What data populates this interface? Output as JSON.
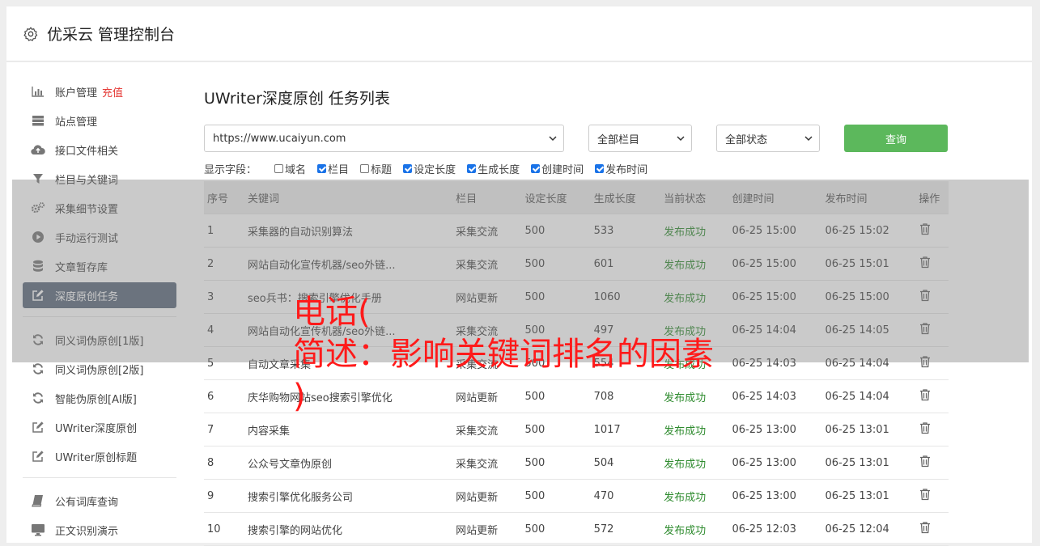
{
  "header": {
    "title": "优采云 管理控制台"
  },
  "sidebar": {
    "group1": [
      {
        "label": "账户管理",
        "extra": "充值",
        "icon": "bar-chart-icon"
      },
      {
        "label": "站点管理",
        "icon": "server-icon"
      },
      {
        "label": "接口文件相关",
        "icon": "cloud-upload-icon"
      },
      {
        "label": "栏目与关键词",
        "icon": "filter-icon"
      },
      {
        "label": "采集细节设置",
        "icon": "gears-icon"
      },
      {
        "label": "手动运行测试",
        "icon": "play-icon"
      },
      {
        "label": "文章暂存库",
        "icon": "database-icon"
      },
      {
        "label": "深度原创任务",
        "icon": "edit-icon",
        "active": true
      }
    ],
    "group2": [
      {
        "label": "同义词伪原创[1版]",
        "icon": "refresh-icon"
      },
      {
        "label": "同义词伪原创[2版]",
        "icon": "refresh-icon"
      },
      {
        "label": "智能伪原创[AI版]",
        "icon": "refresh-icon"
      },
      {
        "label": "UWriter深度原创",
        "icon": "edit-icon"
      },
      {
        "label": "UWriter原创标题",
        "icon": "edit-icon"
      }
    ],
    "group3": [
      {
        "label": "公有词库查询",
        "icon": "book-icon"
      },
      {
        "label": "正文识别演示",
        "icon": "monitor-icon"
      }
    ]
  },
  "main": {
    "title": "UWriter深度原创 任务列表",
    "site_select": "https://www.ucaiyun.com",
    "column_select": "全部栏目",
    "status_select": "全部状态",
    "query_label": "查询",
    "fields_label": "显示字段：",
    "fields": [
      {
        "label": "域名",
        "checked": false
      },
      {
        "label": "栏目",
        "checked": true
      },
      {
        "label": "标题",
        "checked": false
      },
      {
        "label": "设定长度",
        "checked": true
      },
      {
        "label": "生成长度",
        "checked": true
      },
      {
        "label": "创建时间",
        "checked": true
      },
      {
        "label": "发布时间",
        "checked": true
      }
    ],
    "columns": [
      "序号",
      "关键词",
      "栏目",
      "设定长度",
      "生成长度",
      "当前状态",
      "创建时间",
      "发布时间",
      "操作"
    ],
    "rows": [
      [
        "1",
        "采集器的自动识别算法",
        "采集交流",
        "500",
        "533",
        "发布成功",
        "06-25 15:00",
        "06-25 15:02"
      ],
      [
        "2",
        "网站自动化宣传机器/seo外链...",
        "采集交流",
        "500",
        "601",
        "发布成功",
        "06-25 15:00",
        "06-25 15:01"
      ],
      [
        "3",
        "seo兵书：搜索引擎优化手册",
        "网站更新",
        "500",
        "1060",
        "发布成功",
        "06-25 15:00",
        "06-25 15:00"
      ],
      [
        "4",
        "网站自动化宣传机器/seo外链...",
        "采集交流",
        "500",
        "497",
        "发布成功",
        "06-25 14:04",
        "06-25 14:05"
      ],
      [
        "5",
        "自动文章采集",
        "采集交流",
        "500",
        "554",
        "发布成功",
        "06-25 14:03",
        "06-25 14:04"
      ],
      [
        "6",
        "庆华购物网站seo搜索引擎优化",
        "网站更新",
        "500",
        "708",
        "发布成功",
        "06-25 14:03",
        "06-25 14:04"
      ],
      [
        "7",
        "内容采集",
        "采集交流",
        "500",
        "1017",
        "发布成功",
        "06-25 13:00",
        "06-25 13:01"
      ],
      [
        "8",
        "公众号文章伪原创",
        "采集交流",
        "500",
        "504",
        "发布成功",
        "06-25 13:00",
        "06-25 13:01"
      ],
      [
        "9",
        "搜索引擎优化服务公司",
        "网站更新",
        "500",
        "470",
        "发布成功",
        "06-25 13:00",
        "06-25 13:01"
      ],
      [
        "10",
        "搜索引擎的网站优化",
        "网站更新",
        "500",
        "572",
        "发布成功",
        "06-25 12:03",
        "06-25 12:04"
      ]
    ]
  },
  "watermark": "电话(\n简述：影响关键词排名的因素\n)"
}
